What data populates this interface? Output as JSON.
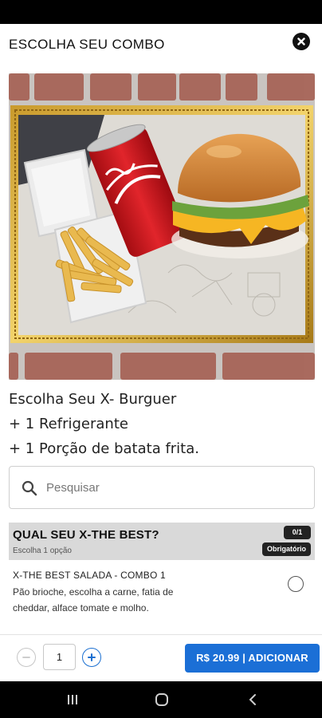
{
  "header": {
    "title": "ESCOLHA SEU COMBO",
    "close_icon": "close-circle-icon"
  },
  "hero": {
    "alt": "Combo: hambúrguer, lata de refrigerante e porção de batata frita"
  },
  "description": {
    "line1": "Escolha Seu X- Burguer",
    "line2": "+ 1 Refrigerante",
    "line3": "+ 1 Porção de batata frita."
  },
  "search": {
    "placeholder": "Pesquisar",
    "value": "",
    "icon": "search-icon"
  },
  "group": {
    "title": "QUAL SEU X-THE BEST?",
    "subtitle": "Escolha 1 opção",
    "count": "0/1",
    "required_label": "Obrigatório"
  },
  "options": [
    {
      "name": "X-THE BEST SALADA - COMBO 1",
      "description": "Pão brioche, escolha a carne, fatia de cheddar, alface tomate e molho.",
      "selected": false
    }
  ],
  "footer": {
    "quantity": "1",
    "add_button_label": "R$ 20.99 | ADICIONAR"
  },
  "colors": {
    "accent": "#1b6fd6",
    "group_header_bg": "#d9d9d9",
    "badge_bg": "#222222"
  },
  "nav": {
    "recents_icon": "recents-icon",
    "home_icon": "home-icon",
    "back_icon": "back-icon"
  }
}
